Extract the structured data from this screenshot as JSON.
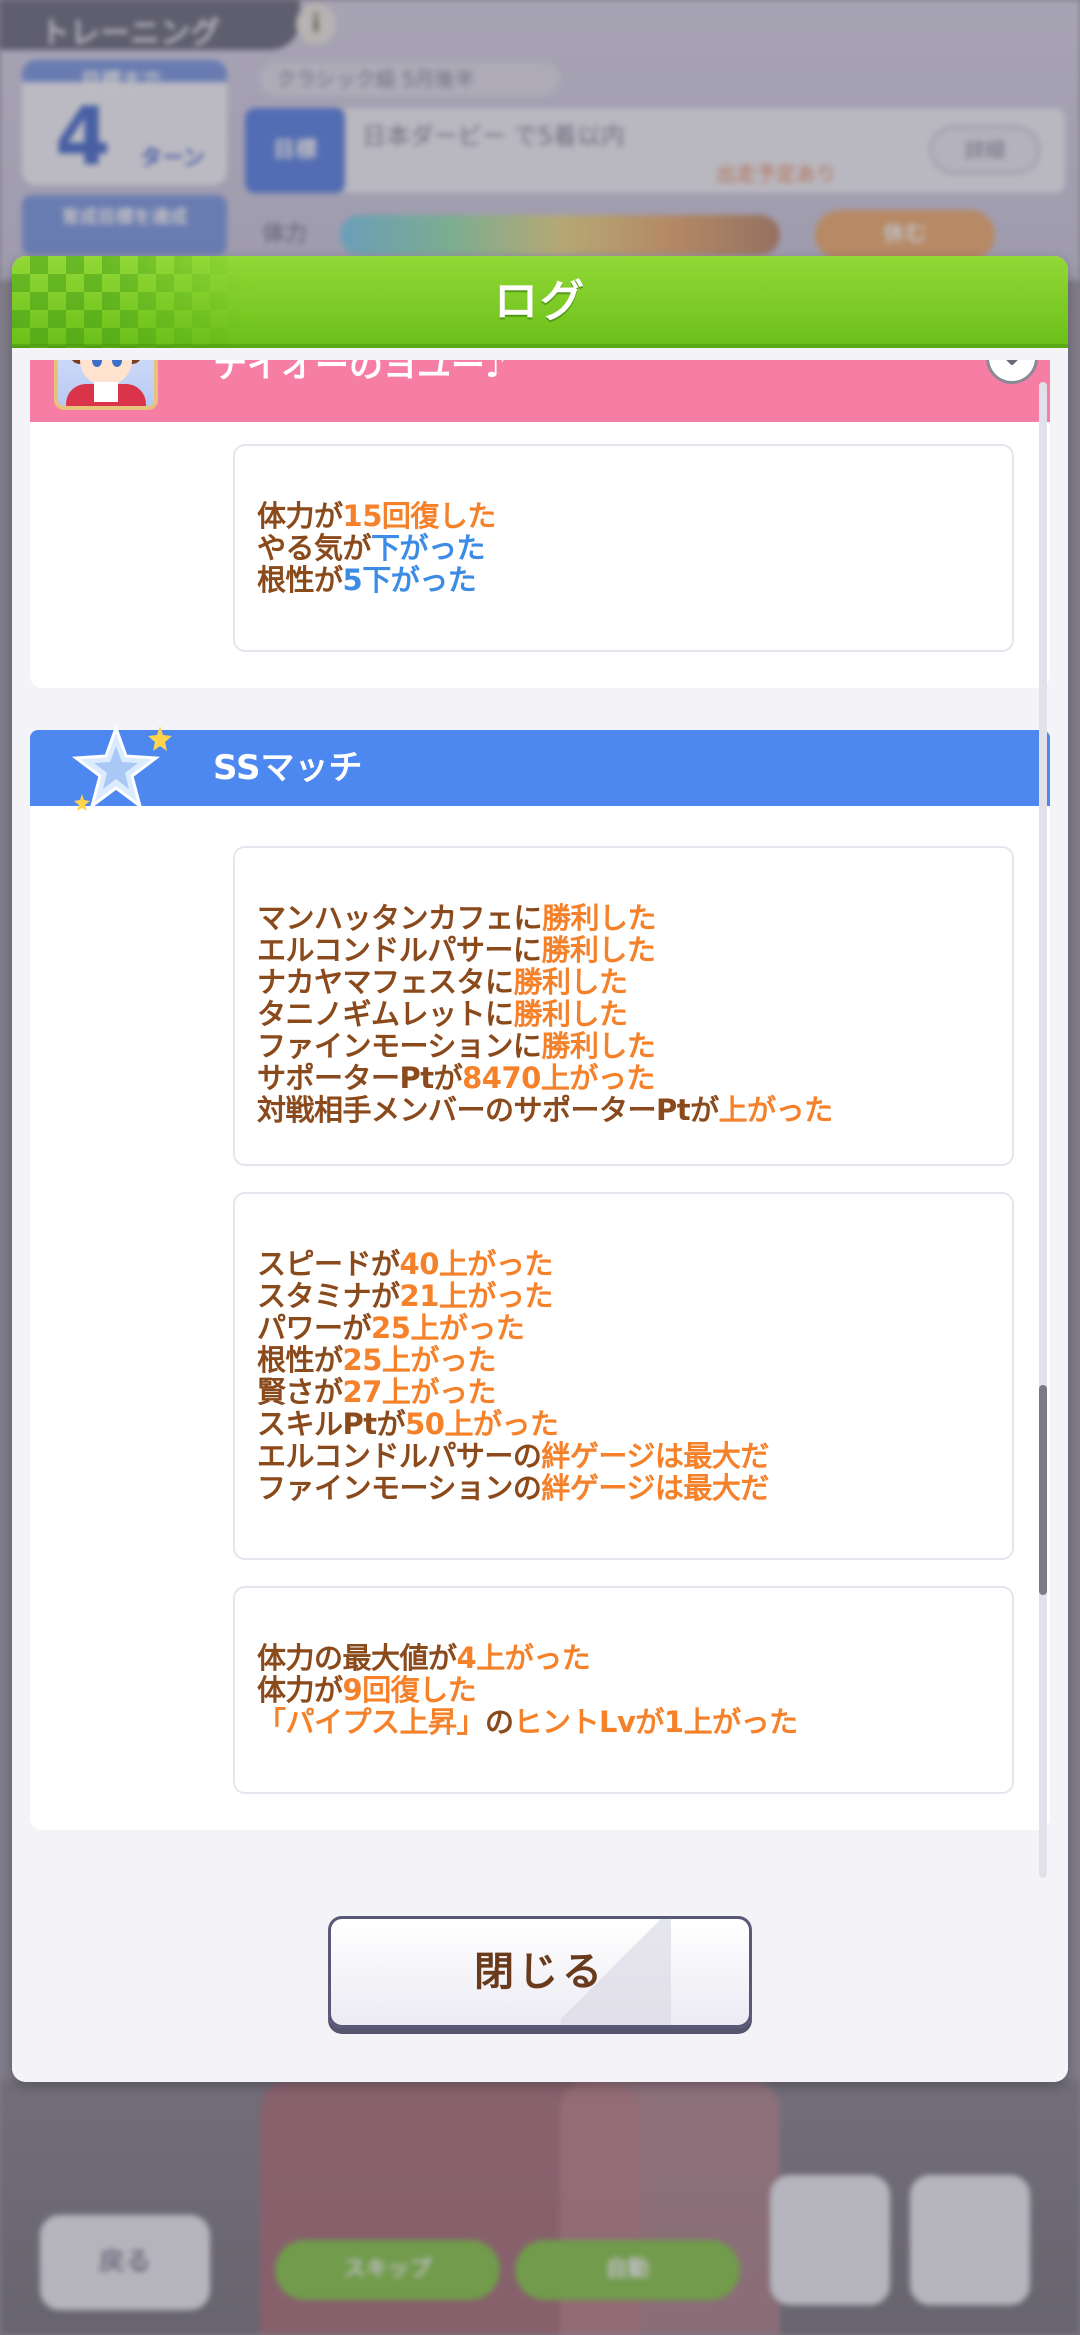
{
  "background": {
    "title": "トレーニング",
    "period": "クラシック級 5月後半",
    "turn_label": "目標まで",
    "turn_number": "4",
    "turn_unit": "ターン",
    "goal_tag": "目標",
    "goal_text": "日本ダービー で5着以内",
    "goal_sub": "出走予定あり",
    "goal_button": "詳細",
    "summary": "育成目標を達成",
    "energy_label": "体力",
    "energy_button": "休む",
    "back_button": "戻る",
    "skip_button": "スキップ",
    "auto_button": "自動",
    "accent_colors": {
      "header_green": "#7acb26",
      "pink": "#f67ea4",
      "blue": "#4d88f0",
      "orange": "#f5822a",
      "brown": "#8a4a1c"
    }
  },
  "dialog": {
    "title": "ログ",
    "close_button": "閉じる",
    "scroll_position": 0.78
  },
  "sections": [
    {
      "name": "テイオーのヨユー♪",
      "icon": "character-portrait-icon",
      "color": "pink",
      "entries": [
        [
          [
            {
              "t": "体力が"
            },
            {
              "t": "15回復した",
              "c": "o"
            }
          ],
          [
            {
              "t": "やる気が"
            },
            {
              "t": "下がった",
              "c": "b"
            }
          ],
          [
            {
              "t": "根性が"
            },
            {
              "t": "5下がった",
              "c": "b"
            }
          ]
        ]
      ]
    },
    {
      "name": "SSマッチ",
      "icon": "star-icon",
      "color": "blue",
      "entries": [
        [
          [
            {
              "t": "マンハッタンカフェに"
            },
            {
              "t": "勝利した",
              "c": "o"
            }
          ],
          [
            {
              "t": "エルコンドルパサーに"
            },
            {
              "t": "勝利した",
              "c": "o"
            }
          ],
          [
            {
              "t": "ナカヤマフェスタに"
            },
            {
              "t": "勝利した",
              "c": "o"
            }
          ],
          [
            {
              "t": "タニノギムレットに"
            },
            {
              "t": "勝利した",
              "c": "o"
            }
          ],
          [
            {
              "t": "ファインモーションに"
            },
            {
              "t": "勝利した",
              "c": "o"
            }
          ],
          [
            {
              "t": "サポーターPtが"
            },
            {
              "t": "8470上がった",
              "c": "o"
            }
          ],
          [
            {
              "t": "対戦相手メンバーのサポーターPtが"
            },
            {
              "t": "上がった",
              "c": "o"
            }
          ]
        ],
        [
          [
            {
              "t": "スピードが"
            },
            {
              "t": "40上がった",
              "c": "o"
            }
          ],
          [
            {
              "t": "スタミナが"
            },
            {
              "t": "21上がった",
              "c": "o"
            }
          ],
          [
            {
              "t": "パワーが"
            },
            {
              "t": "25上がった",
              "c": "o"
            }
          ],
          [
            {
              "t": "根性が"
            },
            {
              "t": "25上がった",
              "c": "o"
            }
          ],
          [
            {
              "t": "賢さが"
            },
            {
              "t": "27上がった",
              "c": "o"
            }
          ],
          [
            {
              "t": "スキルPtが"
            },
            {
              "t": "50上がった",
              "c": "o"
            }
          ],
          [
            {
              "t": "エルコンドルパサーの"
            },
            {
              "t": "絆ゲージは最大だ",
              "c": "o"
            }
          ],
          [
            {
              "t": "ファインモーションの"
            },
            {
              "t": "絆ゲージは最大だ",
              "c": "o"
            }
          ]
        ],
        [
          [
            {
              "t": "体力の最大値が"
            },
            {
              "t": "4上がった",
              "c": "o"
            }
          ],
          [
            {
              "t": "体力が"
            },
            {
              "t": "9回復した",
              "c": "o"
            }
          ],
          [
            {
              "t": "「パイプス上昇」",
              "c": "o"
            },
            {
              "t": "の"
            },
            {
              "t": "ヒントLvが1上がった",
              "c": "o"
            }
          ]
        ]
      ]
    }
  ]
}
